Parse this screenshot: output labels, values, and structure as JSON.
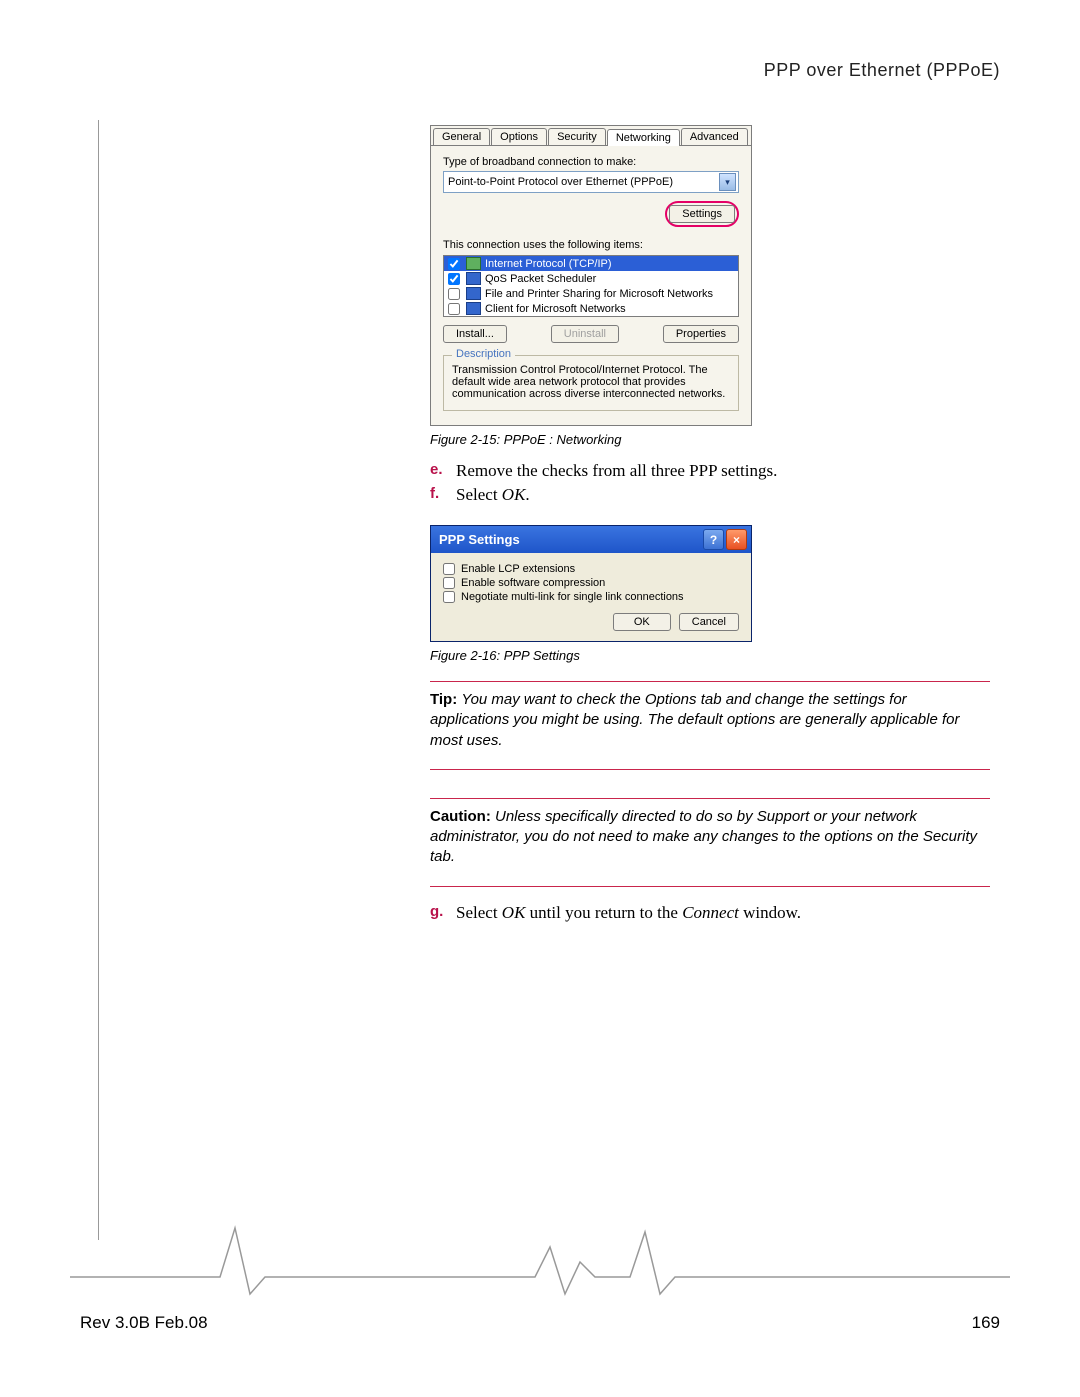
{
  "header": {
    "title": "PPP over Ethernet (PPPoE)"
  },
  "footer": {
    "rev": "Rev 3.0B Feb.08",
    "page": "169"
  },
  "panel1": {
    "tabs": [
      "General",
      "Options",
      "Security",
      "Networking",
      "Advanced"
    ],
    "active_tab_index": 3,
    "type_label": "Type of broadband connection to make:",
    "type_value": "Point-to-Point Protocol over Ethernet (PPPoE)",
    "settings_btn": "Settings",
    "list_label": "This connection uses the following items:",
    "items": [
      {
        "label": "Internet Protocol (TCP/IP)",
        "checked": true,
        "selected": true
      },
      {
        "label": "QoS Packet Scheduler",
        "checked": true,
        "selected": false
      },
      {
        "label": "File and Printer Sharing for Microsoft Networks",
        "checked": false,
        "selected": false
      },
      {
        "label": "Client for Microsoft Networks",
        "checked": false,
        "selected": false
      }
    ],
    "install_btn": "Install...",
    "uninstall_btn": "Uninstall",
    "properties_btn": "Properties",
    "desc_legend": "Description",
    "desc_text": "Transmission Control Protocol/Internet Protocol. The default wide area network protocol that provides communication across diverse interconnected networks."
  },
  "caption1": "Figure 2-15:  PPPoE : Networking",
  "steps1": [
    {
      "letter": "e.",
      "text_plain": "Remove the checks from all three PPP settings."
    },
    {
      "letter": "f.",
      "text_prefix": "Select ",
      "text_em": "OK",
      "text_suffix": "."
    }
  ],
  "dlg": {
    "title": "PPP Settings",
    "opts": [
      "Enable LCP extensions",
      "Enable software compression",
      "Negotiate multi-link for single link connections"
    ],
    "ok": "OK",
    "cancel": "Cancel"
  },
  "caption2": "Figure 2-16:  PPP Settings",
  "tip": {
    "label": "Tip:",
    "text": "You may want to check the Options tab and change the settings for applications you might be using. The default options are generally applicable for most uses."
  },
  "caution": {
    "label": "Caution:",
    "text": "Unless specifically directed to do so by Support or your network administrator, you do not need to make any changes to the options on the Security tab."
  },
  "step_g": {
    "letter": "g.",
    "t1": "Select ",
    "em1": "OK",
    "t2": " until you return to the ",
    "em2": "Connect",
    "t3": " window."
  }
}
